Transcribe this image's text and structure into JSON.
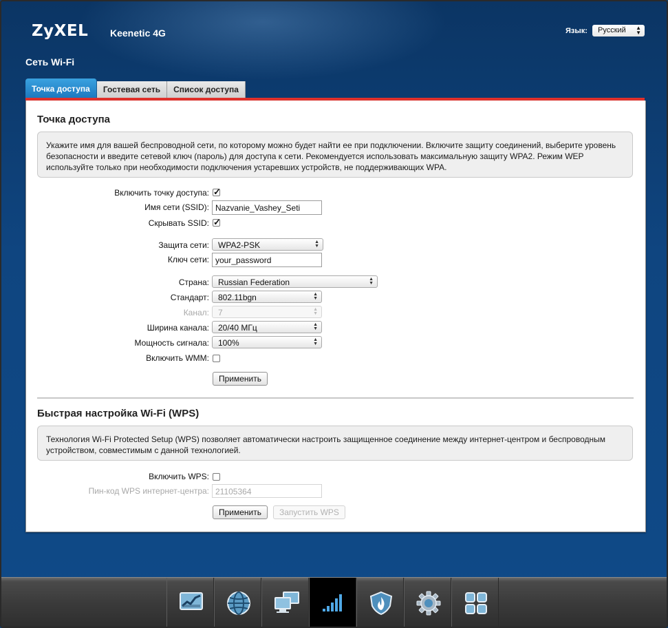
{
  "header": {
    "brand": "ZyXEL",
    "model": "Keenetic 4G",
    "language_label": "Язык:",
    "language_value": "Русский",
    "page_title": "Сеть Wi-Fi"
  },
  "tabs": [
    {
      "label": "Точка доступа",
      "active": true
    },
    {
      "label": "Гостевая сеть",
      "active": false
    },
    {
      "label": "Список доступа",
      "active": false
    }
  ],
  "access_point": {
    "title": "Точка доступа",
    "info": "Укажите имя для вашей беспроводной сети, по которому можно будет найти ее при подключении. Включите защиту соединений, выберите уровень безопасности и введите сетевой ключ (пароль) для доступа к сети. Рекомендуется использовать максимальную защиту WPA2. Режим WEP используйте только при необходимости подключения устаревших устройств, не поддерживающих WPA.",
    "enable_label": "Включить точку доступа:",
    "enable_checked": true,
    "ssid_label": "Имя сети (SSID):",
    "ssid_value": "Nazvanie_Vashey_Seti",
    "hide_ssid_label": "Скрывать SSID:",
    "hide_ssid_checked": true,
    "security_label": "Защита сети:",
    "security_value": "WPA2-PSK",
    "key_label": "Ключ сети:",
    "key_value": "your_password",
    "country_label": "Страна:",
    "country_value": "Russian Federation",
    "standard_label": "Стандарт:",
    "standard_value": "802.11bgn",
    "channel_label": "Канал:",
    "channel_value": "7",
    "width_label": "Ширина канала:",
    "width_value": "20/40 МГц",
    "power_label": "Мощность сигнала:",
    "power_value": "100%",
    "wmm_label": "Включить WMM:",
    "wmm_checked": false,
    "apply_label": "Применить"
  },
  "wps": {
    "title": "Быстрая настройка Wi-Fi (WPS)",
    "info": "Технология Wi-Fi Protected Setup (WPS) позволяет автоматически настроить защищенное соединение между интернет-центром и беспроводным устройством, совместимым с данной технологией.",
    "enable_label": "Включить WPS:",
    "enable_checked": false,
    "pin_label": "Пин-код WPS интернет-центра:",
    "pin_value": "21105364",
    "apply_label": "Применить",
    "start_label": "Запустить WPS"
  },
  "dock": [
    {
      "icon": "monitor-chart-icon",
      "active": false
    },
    {
      "icon": "globe-icon",
      "active": false
    },
    {
      "icon": "network-computers-icon",
      "active": false
    },
    {
      "icon": "wifi-signal-bars-icon",
      "active": true
    },
    {
      "icon": "shield-flame-icon",
      "active": false
    },
    {
      "icon": "gear-icon",
      "active": false
    },
    {
      "icon": "apps-grid-icon",
      "active": false
    }
  ],
  "colors": {
    "background": "#0f4580",
    "tab_active": "#2a8ed4",
    "accent_line": "#e0312b"
  }
}
